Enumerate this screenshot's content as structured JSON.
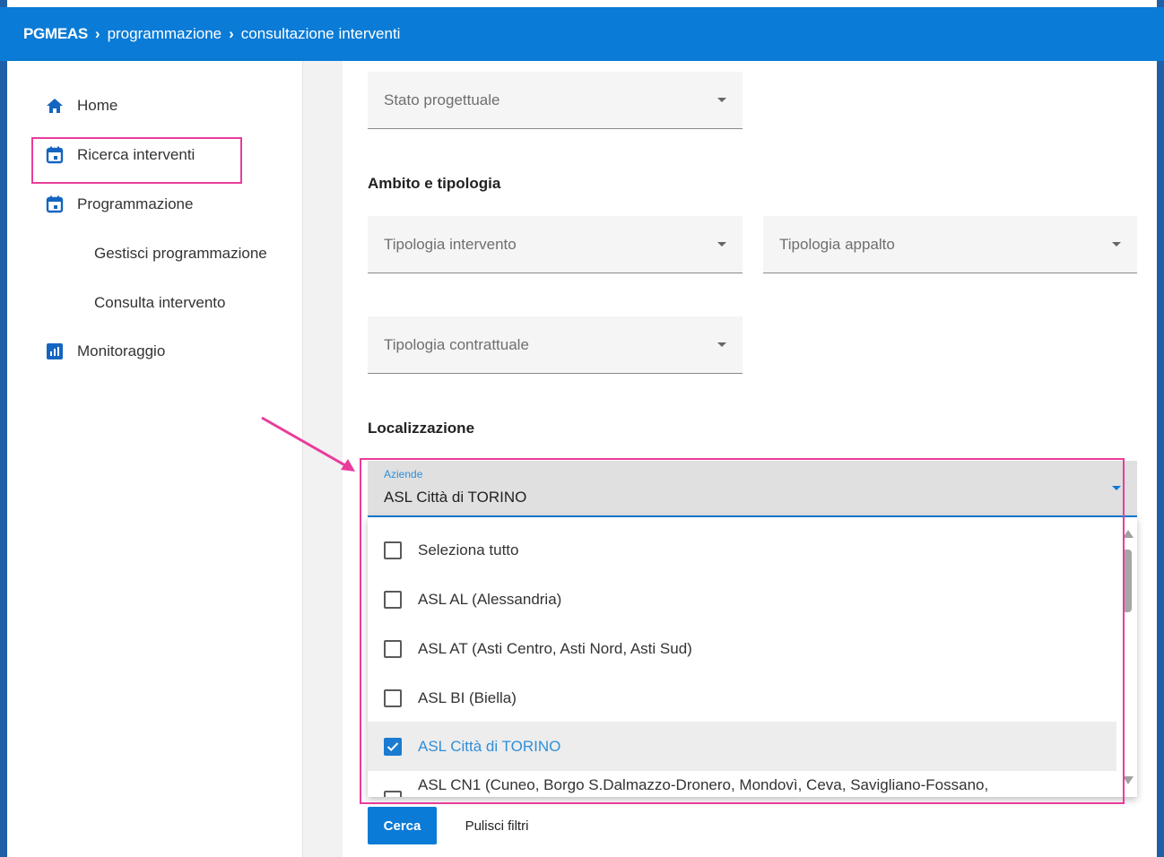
{
  "header": {
    "brand": "PGMEAS",
    "crumb1": "programmazione",
    "crumb2": "consultazione interventi"
  },
  "sidebar": {
    "items": [
      {
        "label": "Home",
        "icon": "home-icon"
      },
      {
        "label": "Ricerca interventi",
        "icon": "calendar-icon"
      },
      {
        "label": "Programmazione",
        "icon": "calendar-icon"
      },
      {
        "label": "Gestisci programmazione"
      },
      {
        "label": "Consulta intervento"
      },
      {
        "label": "Monitoraggio",
        "icon": "bar-chart-icon"
      }
    ]
  },
  "filters": {
    "stato_progettuale": "Stato progettuale",
    "section_ambito": "Ambito e tipologia",
    "tipologia_intervento": "Tipologia intervento",
    "tipologia_appalto": "Tipologia appalto",
    "tipologia_contrattuale": "Tipologia contrattuale",
    "section_localizzazione": "Localizzazione",
    "aziende_label": "Aziende",
    "aziende_value": "ASL Città di TORINO"
  },
  "dropdown": {
    "options": [
      {
        "label": "Seleziona tutto",
        "checked": false
      },
      {
        "label": "ASL AL (Alessandria)",
        "checked": false
      },
      {
        "label": "ASL AT (Asti Centro, Asti Nord, Asti Sud)",
        "checked": false
      },
      {
        "label": "ASL BI (Biella)",
        "checked": false
      },
      {
        "label": "ASL Città di TORINO",
        "checked": true
      },
      {
        "label": "ASL CN1 (Cuneo, Borgo S.Dalmazzo-Dronero, Mondovì, Ceva, Savigliano-Fossano,",
        "checked": false
      }
    ]
  },
  "actions": {
    "cerca": "Cerca",
    "pulisci": "Pulisci filtri"
  },
  "colors": {
    "header": "#0a7bd6",
    "accent": "#1a7bd0",
    "annotation": "#e83d9a"
  }
}
